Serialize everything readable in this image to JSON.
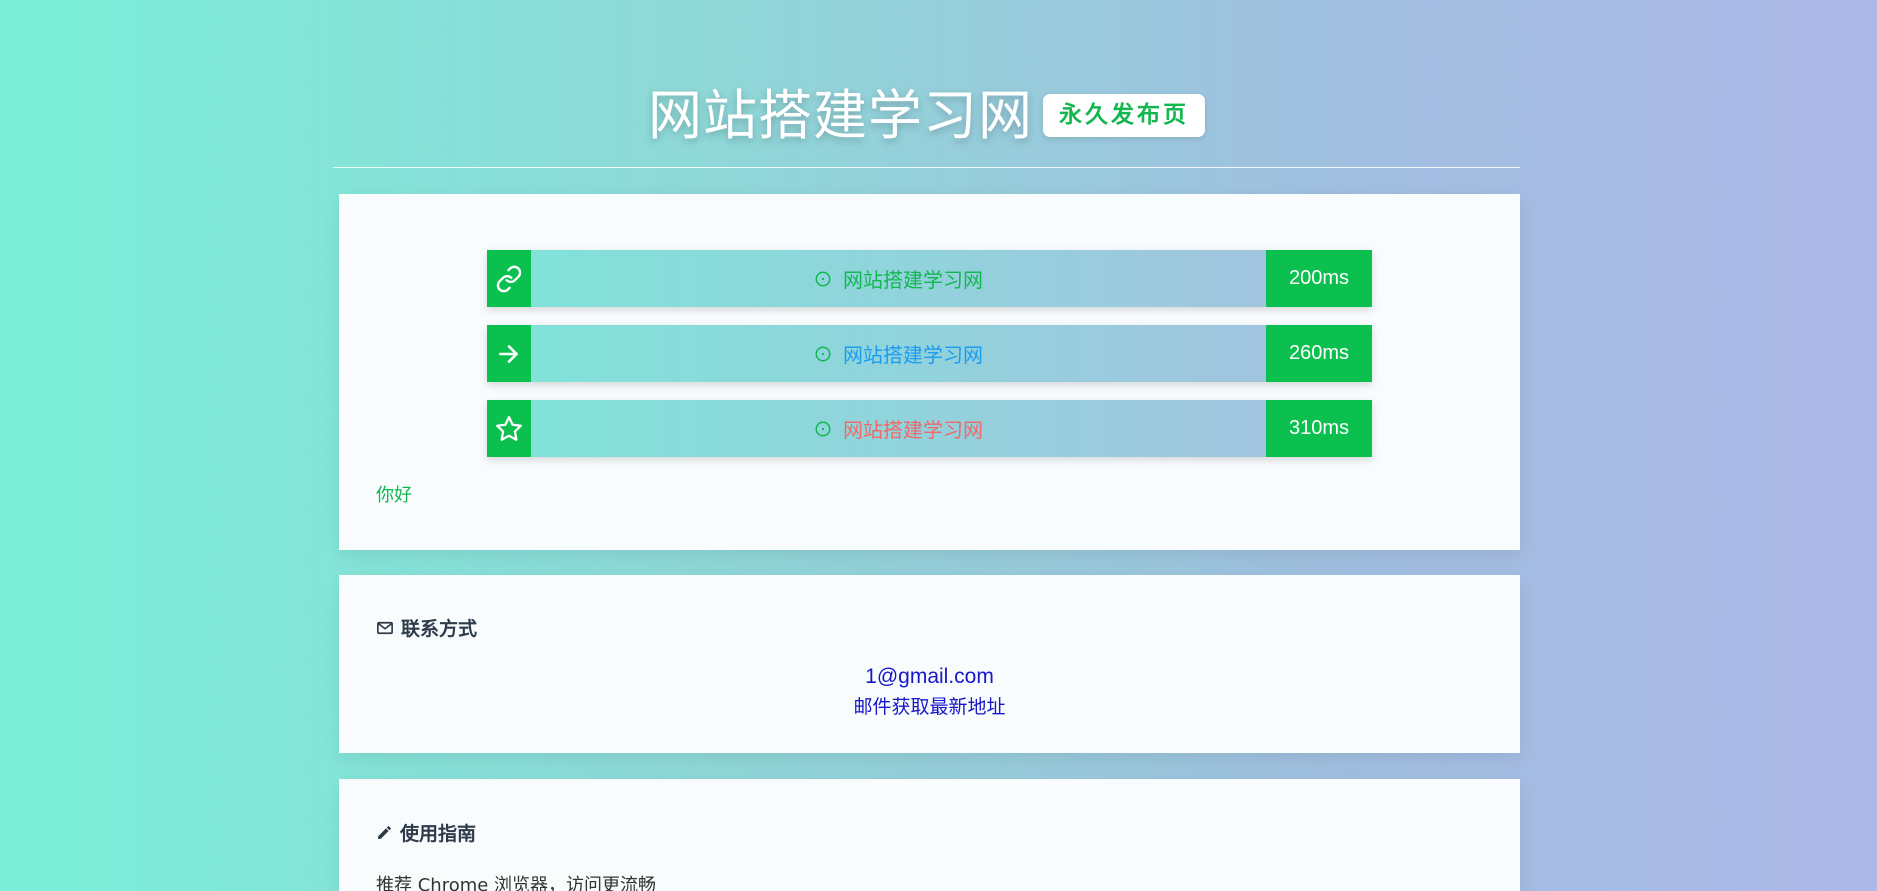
{
  "header": {
    "title": "网站搭建学习网",
    "badge": "永久发布页"
  },
  "links": [
    {
      "icon": "link-icon",
      "label": "网站搭建学习网",
      "label_color": "#13b74f",
      "latency": "200ms"
    },
    {
      "icon": "arrow-right-icon",
      "label": "网站搭建学习网",
      "label_color": "#1a9cf0",
      "latency": "260ms"
    },
    {
      "icon": "star-icon",
      "label": "网站搭建学习网",
      "label_color": "#f06868",
      "latency": "310ms"
    }
  ],
  "greeting": "你好",
  "contact": {
    "heading": "联系方式",
    "email": "1@gmail.com",
    "note": "邮件获取最新地址"
  },
  "guide": {
    "heading": "使用指南",
    "text": "推荐 Chrome 浏览器，访问更流畅"
  },
  "colors": {
    "accent_green": "#0cc04f",
    "text_green": "#13b74f",
    "link_blue": "#1717c9"
  }
}
